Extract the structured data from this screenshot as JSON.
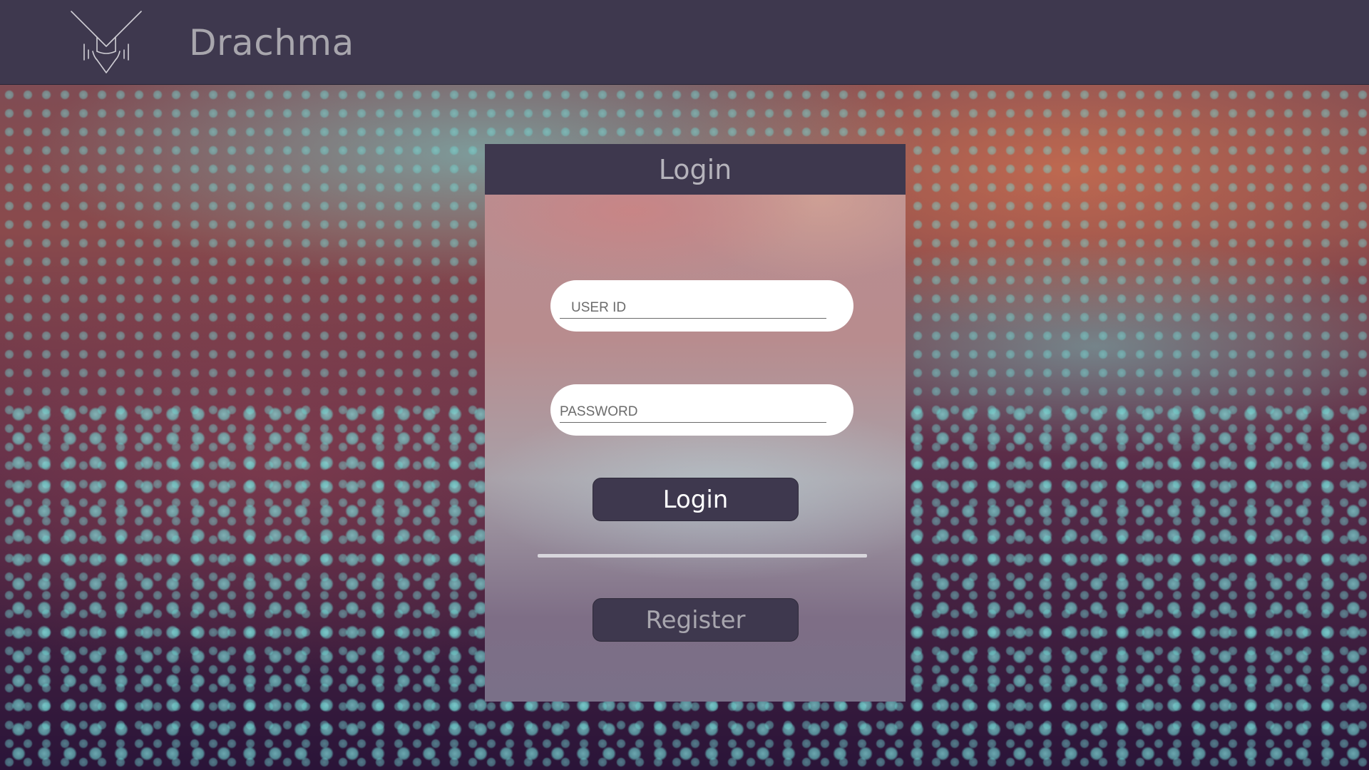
{
  "app": {
    "title": "Drachma",
    "logo_icon": "owl-logo-icon"
  },
  "login_panel": {
    "title": "Login",
    "user_id_field": {
      "placeholder": "USER ID",
      "value": ""
    },
    "password_field": {
      "placeholder": "PASSWORD",
      "value": ""
    },
    "login_label": "Login",
    "register_label": "Register"
  },
  "colors": {
    "header_bg": "#3e384e",
    "button_bg": "#3e384e",
    "accent_cyan": "#6fd8d4",
    "background_rust": "#c06a48"
  }
}
